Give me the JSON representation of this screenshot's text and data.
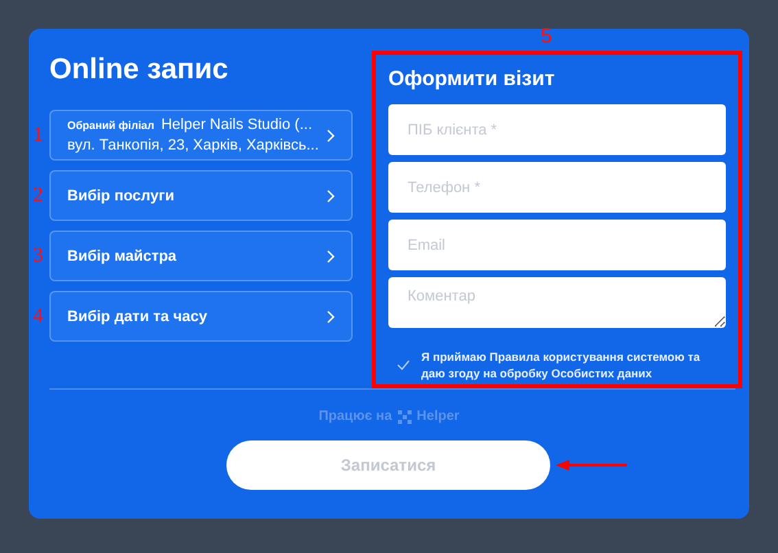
{
  "title": "Online запис",
  "steps": [
    {
      "kind": "branch",
      "marker": "1",
      "label": "Обраний філіал",
      "value": "Helper Nails Studio (...",
      "address": "вул. Танкопія, 23, Харків, Харківсь..."
    },
    {
      "kind": "plain",
      "marker": "2",
      "label": "Вибір послуги"
    },
    {
      "kind": "plain",
      "marker": "3",
      "label": "Вибір майстра"
    },
    {
      "kind": "plain",
      "marker": "4",
      "label": "Вибір дати та часу"
    }
  ],
  "visit_form": {
    "marker": "5",
    "title": "Оформити візит",
    "fields": [
      {
        "kind": "input",
        "placeholder": "ПІБ клієнта *"
      },
      {
        "kind": "input",
        "placeholder": "Телефон *"
      },
      {
        "kind": "input",
        "placeholder": "Email"
      },
      {
        "kind": "textarea",
        "placeholder": "Коментар"
      }
    ],
    "consent": {
      "checked": true,
      "text": "Я приймаю **Правила користування** системою та даю згоду на обробку **Особистих даних**"
    }
  },
  "powered_by": {
    "text": "Працює на",
    "brand": "Helper"
  },
  "submit": {
    "label": "Записатися",
    "disabled": true
  }
}
